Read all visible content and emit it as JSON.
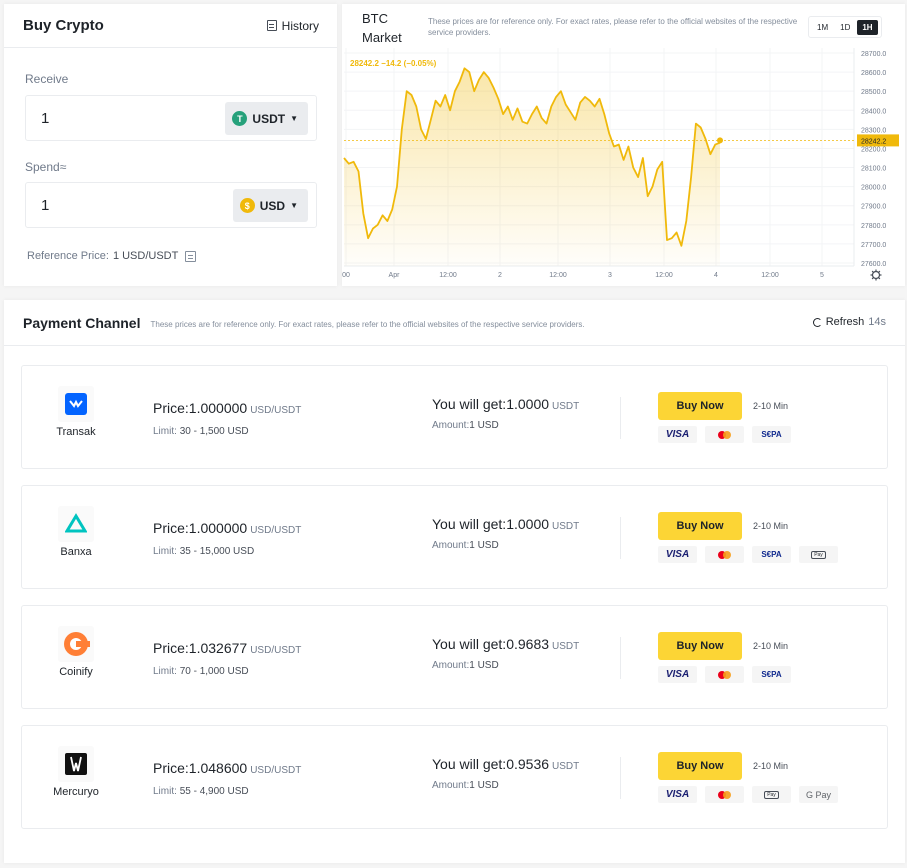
{
  "buy": {
    "title": "Buy Crypto",
    "history": "History",
    "receive_label": "Receive",
    "receive_value": "1",
    "receive_currency": "USDT",
    "spend_label": "Spend≈",
    "spend_value": "1",
    "spend_currency": "USD",
    "ref_label": "Reference Price:",
    "ref_value": "1 USD/USDT"
  },
  "market": {
    "title": "BTC Market",
    "note": "These prices are for reference only. For exact rates, please refer to the official websites of the respective service providers.",
    "ranges": [
      "1M",
      "1D",
      "1H"
    ],
    "active_range": "1H",
    "current_label": "28242.2",
    "change_label": "28242.2 −14.2 (−0.05%)",
    "line_color": "#f0b90b"
  },
  "chart_data": {
    "type": "area",
    "title": "BTC Market",
    "x_ticks": [
      "00",
      "Apr",
      "12:00",
      "2",
      "12:00",
      "3",
      "12:00",
      "4",
      "12:00",
      "5"
    ],
    "y_ticks": [
      "28700.0",
      "28600.0",
      "28500.0",
      "28400.0",
      "28300.0",
      "28200.0",
      "28100.0",
      "28000.0",
      "27900.0",
      "27800.0",
      "27700.0",
      "27600.0"
    ],
    "ylim": [
      27600,
      28700
    ],
    "values": [
      28150,
      28120,
      28130,
      28080,
      27860,
      27730,
      27780,
      27800,
      27850,
      27820,
      27880,
      28000,
      28300,
      28500,
      28480,
      28420,
      28300,
      28250,
      28350,
      28450,
      28420,
      28480,
      28400,
      28500,
      28550,
      28620,
      28600,
      28500,
      28560,
      28600,
      28570,
      28520,
      28460,
      28380,
      28420,
      28350,
      28410,
      28340,
      28330,
      28380,
      28420,
      28360,
      28330,
      28420,
      28470,
      28500,
      28430,
      28390,
      28350,
      28440,
      28470,
      28450,
      28420,
      28460,
      28380,
      28280,
      28210,
      28220,
      28140,
      28210,
      28100,
      28050,
      28150,
      27950,
      28000,
      28090,
      28130,
      27720,
      27730,
      27760,
      27690,
      27820,
      28050,
      28330,
      28310,
      28250,
      28170,
      28220,
      28230
    ],
    "current": 28242.2
  },
  "payment": {
    "title": "Payment Channel",
    "note": "These prices are for reference only. For exact rates, please refer to the official websites of the respective service providers.",
    "refresh_label": "Refresh",
    "refresh_seconds": "14s",
    "buy_label": "Buy Now",
    "providers": [
      {
        "name": "Transak",
        "price_label": "Price:",
        "price": "1.000000",
        "price_unit": "USD/USDT",
        "limit_label": "Limit:",
        "limit": "30 - 1,500 USD",
        "get_label": "You will get:",
        "get": "1.0000",
        "get_unit": "USDT",
        "amount_label": "Amount:",
        "amount": "1 USD",
        "eta": "2-10 Min",
        "methods": [
          "VISA",
          "mastercard",
          "SEPA"
        ]
      },
      {
        "name": "Banxa",
        "price_label": "Price:",
        "price": "1.000000",
        "price_unit": "USD/USDT",
        "limit_label": "Limit:",
        "limit": "35 - 15,000 USD",
        "get_label": "You will get:",
        "get": "1.0000",
        "get_unit": "USDT",
        "amount_label": "Amount:",
        "amount": "1 USD",
        "eta": "2-10 Min",
        "methods": [
          "VISA",
          "mastercard",
          "SEPA",
          "Apple Pay"
        ]
      },
      {
        "name": "Coinify",
        "price_label": "Price:",
        "price": "1.032677",
        "price_unit": "USD/USDT",
        "limit_label": "Limit:",
        "limit": "70 - 1,000 USD",
        "get_label": "You will get:",
        "get": "0.9683",
        "get_unit": "USDT",
        "amount_label": "Amount:",
        "amount": "1 USD",
        "eta": "2-10 Min",
        "methods": [
          "VISA",
          "mastercard",
          "SEPA"
        ]
      },
      {
        "name": "Mercuryo",
        "price_label": "Price:",
        "price": "1.048600",
        "price_unit": "USD/USDT",
        "limit_label": "Limit:",
        "limit": "55 - 4,900 USD",
        "get_label": "You will get:",
        "get": "0.9536",
        "get_unit": "USDT",
        "amount_label": "Amount:",
        "amount": "1 USD",
        "eta": "2-10 Min",
        "methods": [
          "VISA",
          "mastercard",
          "Apple Pay",
          "G Pay"
        ]
      }
    ]
  }
}
